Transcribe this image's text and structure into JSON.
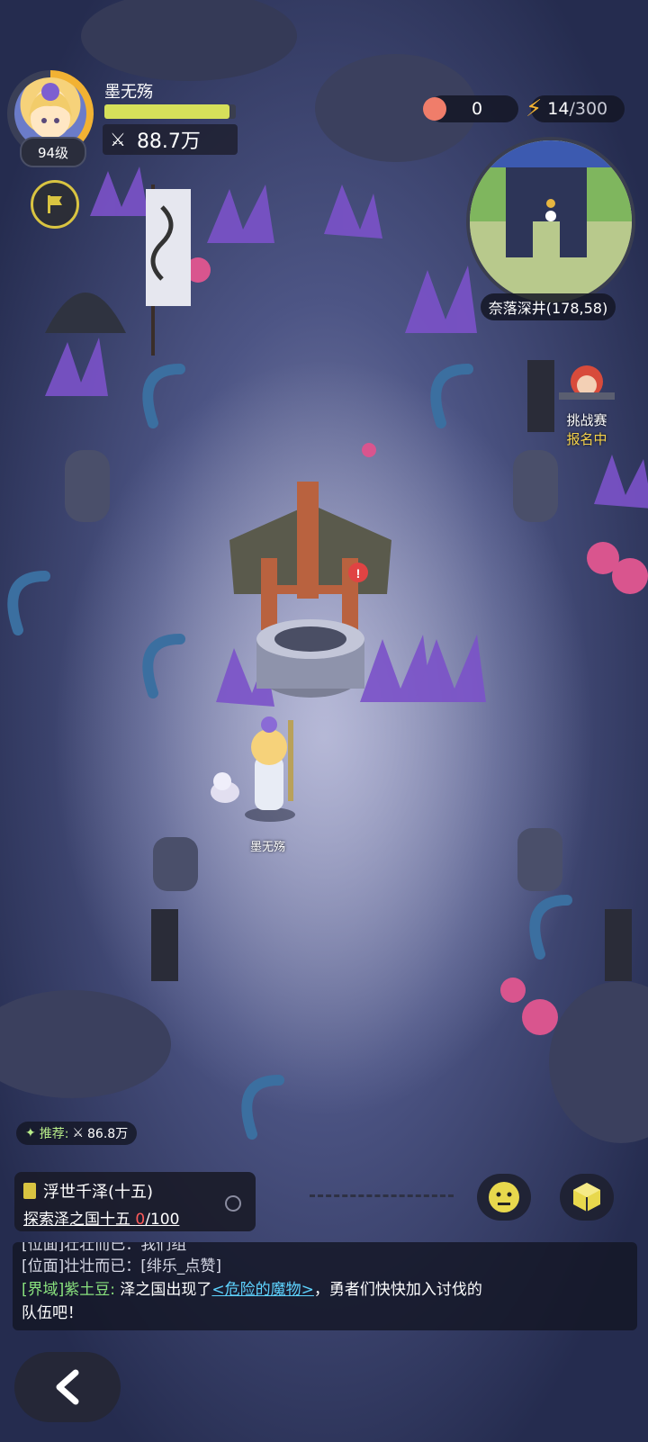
{
  "player": {
    "name": "墨无殇",
    "level": "94级",
    "power": "88.7万",
    "hp_fraction": 0.95
  },
  "resources": {
    "peach_count": "0",
    "energy_current": "14",
    "energy_max": "/300"
  },
  "minimap": {
    "location": "奈落深井(178,58)"
  },
  "challenge": {
    "title": "挑战赛",
    "status": "报名中"
  },
  "character_label": "墨无殇",
  "quest": {
    "recommend_label": "推荐:",
    "recommend_power": "86.8万",
    "title": "浮世千泽(十五)",
    "objective": "探索泽之国十五 ",
    "progress_current": "0",
    "progress_total": "/100"
  },
  "chat": {
    "line0": "[位面]壮壮而已：我们组",
    "line1": "[位面]壮壮而已：[绯乐_点赞]",
    "line2_channel": "[界域]",
    "line2_speaker": "紫土豆:",
    "line2_pre": " 泽之国出现了",
    "line2_link": "<危险的魔物>",
    "line2_post": "，勇者们快快加入讨伐的",
    "line3": "队伍吧！"
  },
  "colors": {
    "accent_gold": "#f2b233",
    "hp_green": "#d6e05a",
    "progress_red": "#ff5b5b"
  }
}
